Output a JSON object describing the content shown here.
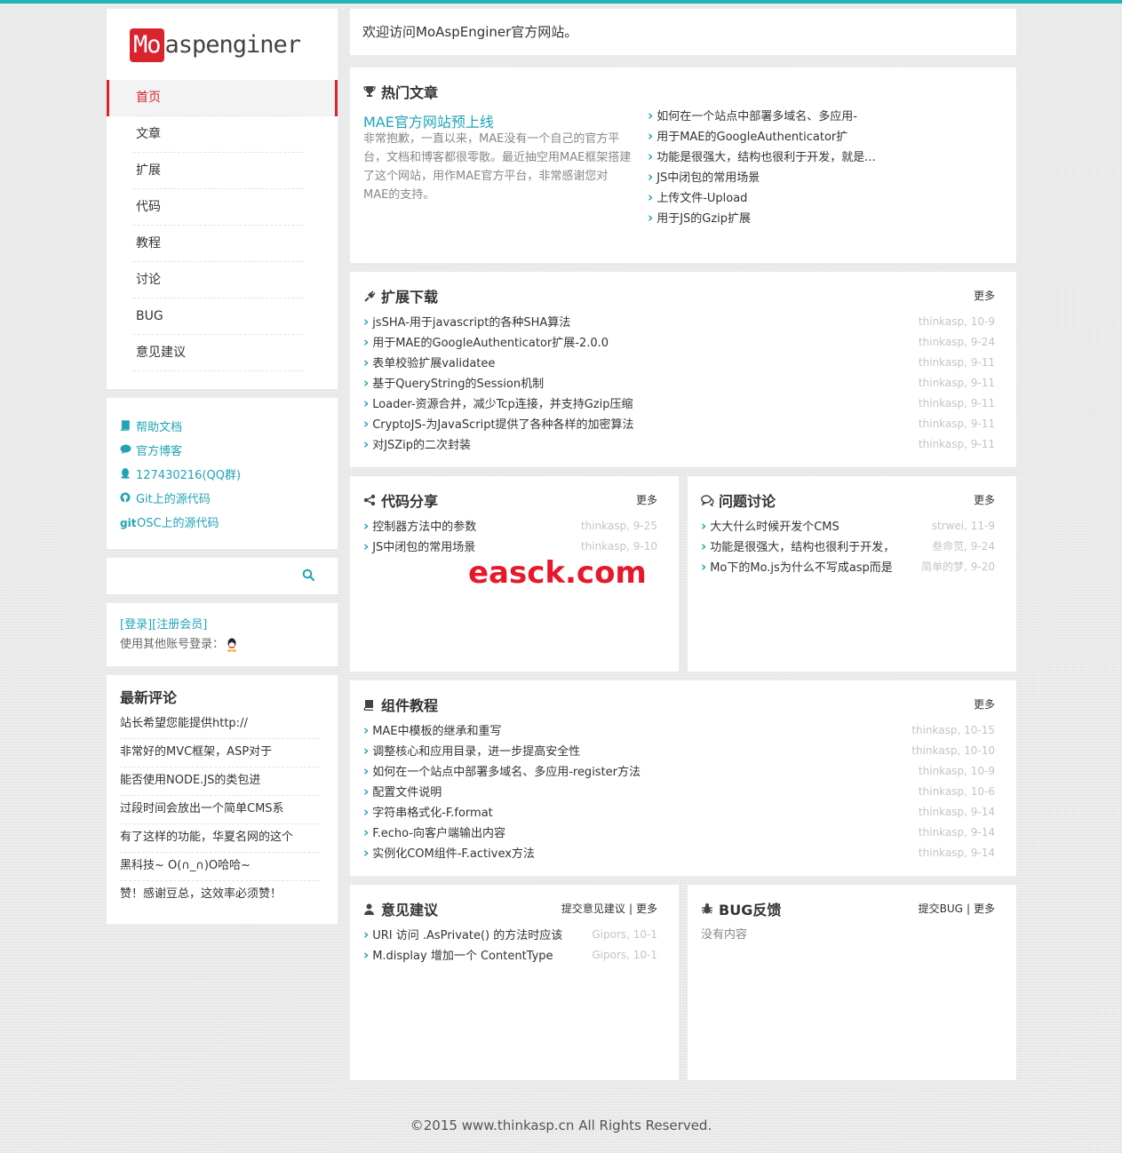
{
  "site": {
    "logo_badge": "Mo",
    "logo_text": "aspenginer",
    "welcome": "欢迎访问MoAspEnginer官方网站。",
    "footer": "©2015 www.thinkasp.cn All Rights Reserved.",
    "watermark": "easck.com",
    "accent": "#20a4b6",
    "brand_red": "#d9232d"
  },
  "nav": {
    "items": [
      {
        "label": "首页",
        "active": true
      },
      {
        "label": "文章"
      },
      {
        "label": "扩展"
      },
      {
        "label": "代码"
      },
      {
        "label": "教程"
      },
      {
        "label": "讨论"
      },
      {
        "label": "BUG"
      },
      {
        "label": "意见建议"
      }
    ]
  },
  "links": [
    {
      "icon": "book-icon",
      "label": "帮助文档"
    },
    {
      "icon": "comment-icon",
      "label": "官方博客"
    },
    {
      "icon": "qq-icon",
      "label": "127430216(QQ群)"
    },
    {
      "icon": "github-icon",
      "label": "Git上的源代码"
    },
    {
      "icon": "git-icon",
      "label": "OSC上的源代码",
      "prefix": "git"
    }
  ],
  "search": {
    "icon": "search-icon"
  },
  "login": {
    "login": "[登录]",
    "register": "[注册会员]",
    "other": "使用其他账号登录："
  },
  "comments": {
    "title": "最新评论",
    "items": [
      "站长希望您能提供http://",
      "非常好的MVC框架，ASP对于",
      "能否使用NODE.JS的类包进",
      "过段时间会放出一个简单CMS系",
      "有了这样的功能，华夏名网的这个",
      "黑科技~ O(∩_∩)O哈哈~",
      "赞！感谢豆总，这效率必须赞！"
    ]
  },
  "hot": {
    "title": "热门文章",
    "main_title": "MAE官方网站预上线",
    "main_desc": "非常抱歉，一直以来，MAE没有一个自己的官方平台，文档和博客都很零散。最近抽空用MAE框架搭建了这个网站，用作MAE官方平台，非常感谢您对MAE的支持。",
    "items": [
      "如何在一个站点中部署多域名、多应用-",
      "用于MAE的GoogleAuthenticator扩",
      "功能是很强大，结构也很利于开发，就是...",
      "JS中闭包的常用场景",
      "上传文件-Upload",
      "用于JS的Gzip扩展"
    ]
  },
  "ext": {
    "title": "扩展下载",
    "more": "更多",
    "items": [
      {
        "t": "jsSHA-用于javascript的各种SHA算法",
        "m": "thinkasp, 10-9"
      },
      {
        "t": "用于MAE的GoogleAuthenticator扩展-2.0.0",
        "m": "thinkasp, 9-24"
      },
      {
        "t": "表单校验扩展validatee",
        "m": "thinkasp, 9-11"
      },
      {
        "t": "基于QueryString的Session机制",
        "m": "thinkasp, 9-11"
      },
      {
        "t": "Loader-资源合并，减少Tcp连接，并支持Gzip压缩",
        "m": "thinkasp, 9-11"
      },
      {
        "t": "CryptoJS-为JavaScript提供了各种各样的加密算法",
        "m": "thinkasp, 9-11"
      },
      {
        "t": "对JSZip的二次封装",
        "m": "thinkasp, 9-11"
      }
    ]
  },
  "code": {
    "title": "代码分享",
    "more": "更多",
    "items": [
      {
        "t": "控制器方法中的参数",
        "m": "thinkasp, 9-25"
      },
      {
        "t": "JS中闭包的常用场景",
        "m": "thinkasp, 9-10"
      }
    ]
  },
  "discuss": {
    "title": "问题讨论",
    "more": "更多",
    "items": [
      {
        "t": "大大什么时候开发个CMS",
        "m": "strwei, 11-9"
      },
      {
        "t": "功能是很强大，结构也很利于开发，",
        "m": "叁命苋, 9-24"
      },
      {
        "t": "Mo下的Mo.js为什么不写成asp而是",
        "m": "简单的梦, 9-20"
      }
    ]
  },
  "tut": {
    "title": "组件教程",
    "more": "更多",
    "items": [
      {
        "t": "MAE中模板的继承和重写",
        "m": "thinkasp, 10-15"
      },
      {
        "t": "调整核心和应用目录，进一步提高安全性",
        "m": "thinkasp, 10-10"
      },
      {
        "t": "如何在一个站点中部署多域名、多应用-register方法",
        "m": "thinkasp, 10-9"
      },
      {
        "t": "配置文件说明",
        "m": "thinkasp, 10-6"
      },
      {
        "t": "字符串格式化-F.format",
        "m": "thinkasp, 9-14"
      },
      {
        "t": "F.echo-向客户端输出内容",
        "m": "thinkasp, 9-14"
      },
      {
        "t": "实例化COM组件-F.activex方法",
        "m": "thinkasp, 9-14"
      }
    ]
  },
  "advice": {
    "title": "意见建议",
    "submit": "提交意见建议",
    "sep": "|",
    "more": "更多",
    "items": [
      {
        "t": "URI 访问 .AsPrivate() 的方法时应该",
        "m": "Gipors, 10-1"
      },
      {
        "t": "M.display 增加一个 ContentType",
        "m": "Gipors, 10-1"
      }
    ]
  },
  "bug": {
    "title": "BUG反馈",
    "submit": "提交BUG",
    "sep": "|",
    "more": "更多",
    "empty": "没有内容"
  }
}
